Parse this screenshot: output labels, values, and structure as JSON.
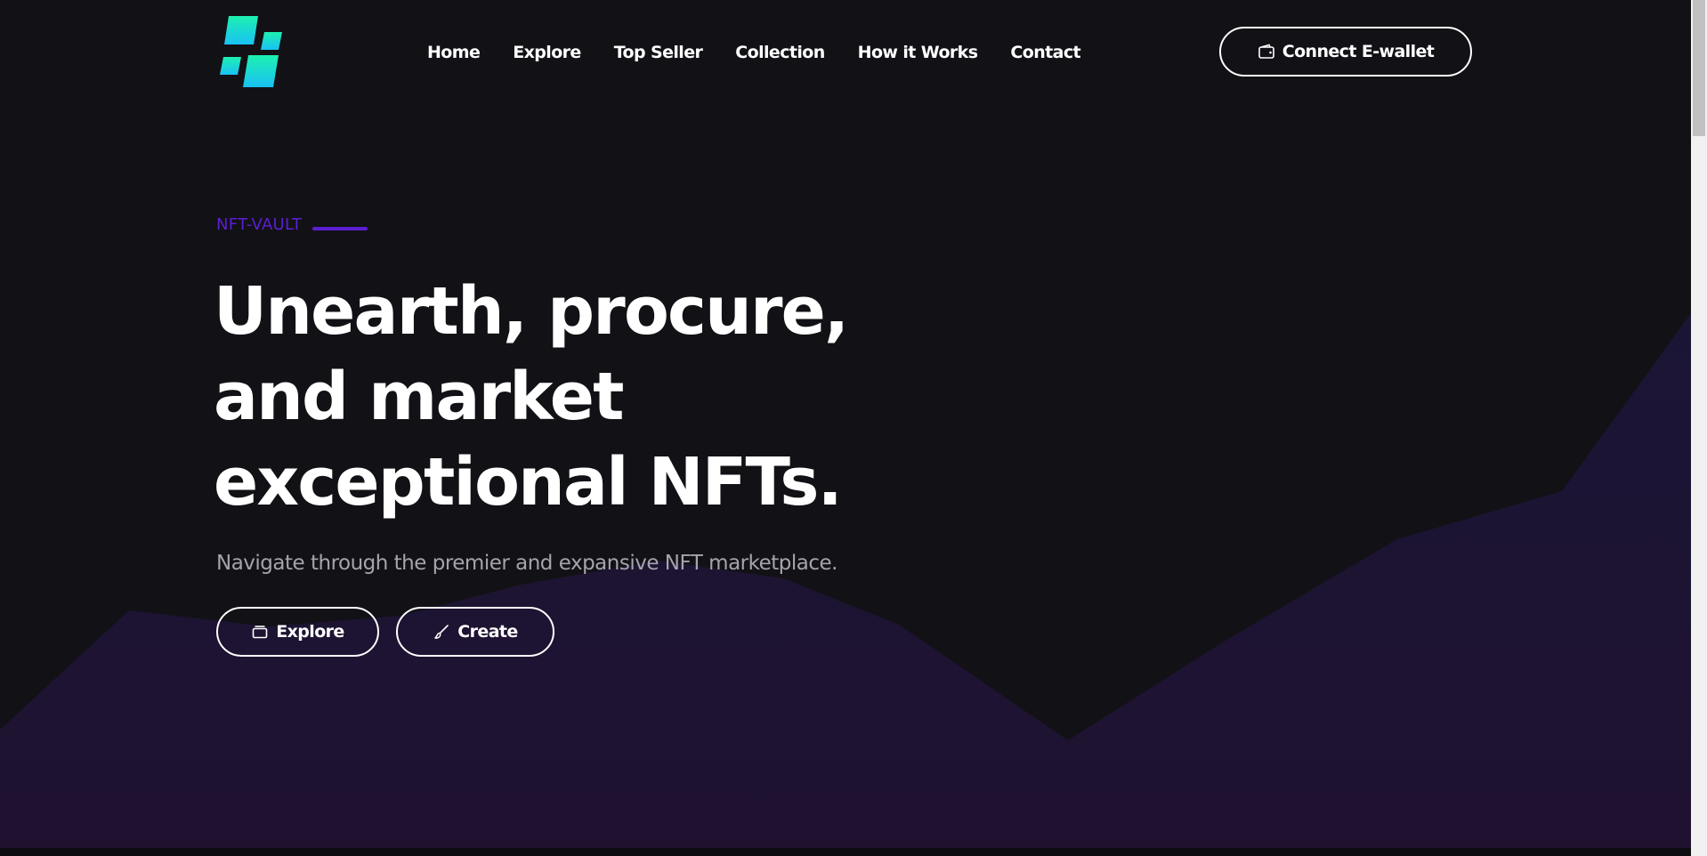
{
  "nav": {
    "items": [
      {
        "label": "Home"
      },
      {
        "label": "Explore"
      },
      {
        "label": "Top Seller"
      },
      {
        "label": "Collection"
      },
      {
        "label": "How it Works"
      },
      {
        "label": "Contact"
      }
    ],
    "connect_label": "Connect E-wallet"
  },
  "hero": {
    "eyebrow": "NFT-VAULT",
    "headline": {
      "line1": "Unearth, procure,",
      "line2": "and market",
      "line3": "exceptional NFTs."
    },
    "subtitle": "Navigate through the premier and expansive NFT marketplace.",
    "explore_label": "Explore",
    "create_label": "Create"
  },
  "icons": {
    "logo": "logo-icon",
    "wallet": "wallet-icon",
    "explore": "folder-icon",
    "create": "brush-icon"
  },
  "colors": {
    "background": "#121116",
    "accent": "#5a1fd1",
    "text": "#ffffff",
    "muted_text": "#a5a4ad",
    "wave": "#1c1434",
    "logo_gradient_start": "#1df0b0",
    "logo_gradient_end": "#19c2f4"
  }
}
